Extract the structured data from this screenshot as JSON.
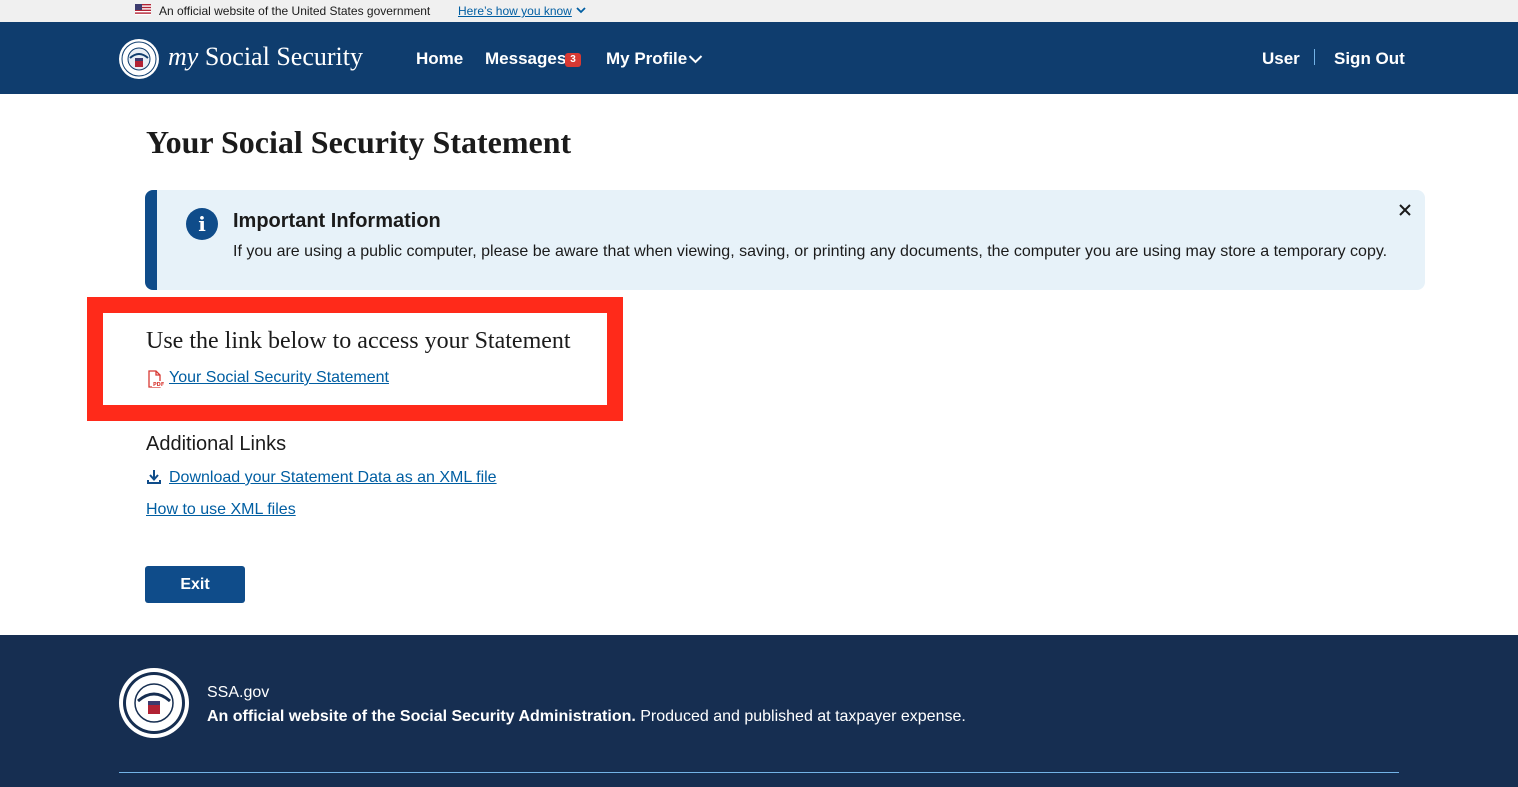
{
  "gov_banner": {
    "text": "An official website of the United States government",
    "link_label": "Here’s how you know"
  },
  "header": {
    "logo_my": "my",
    "logo_rest": "Social Security",
    "nav": {
      "home": "Home",
      "messages": "Messages",
      "messages_count": "3",
      "profile": "My Profile",
      "user": "User",
      "sign_out": "Sign Out"
    }
  },
  "main": {
    "title": "Your Social Security Statement",
    "alert": {
      "title": "Important Information",
      "body": "If you are using a public computer, please be aware that when viewing, saving, or printing any documents, the computer you are using may store a temporary copy.",
      "icon": "info-icon"
    },
    "statement": {
      "heading": "Use the link below to access your Statement",
      "link_label": "Your Social Security Statement",
      "icon": "pdf-icon"
    },
    "additional": {
      "heading": "Additional Links",
      "download_label": "Download your Statement Data as an XML file",
      "howto_label": "How to use XML files"
    },
    "exit_label": "Exit"
  },
  "footer": {
    "site": "SSA.gov",
    "official_bold": "An official website of the Social Security Administration.",
    "official_rest": " Produced and published at taxpayer expense."
  },
  "colors": {
    "header_bg": "#0f3d6e",
    "footer_bg": "#162e51",
    "link": "#005ea2",
    "alert_bg": "#e7f2f9",
    "alert_border": "#0f4c8a",
    "highlight": "#ff2a1a",
    "badge": "#d83933"
  }
}
